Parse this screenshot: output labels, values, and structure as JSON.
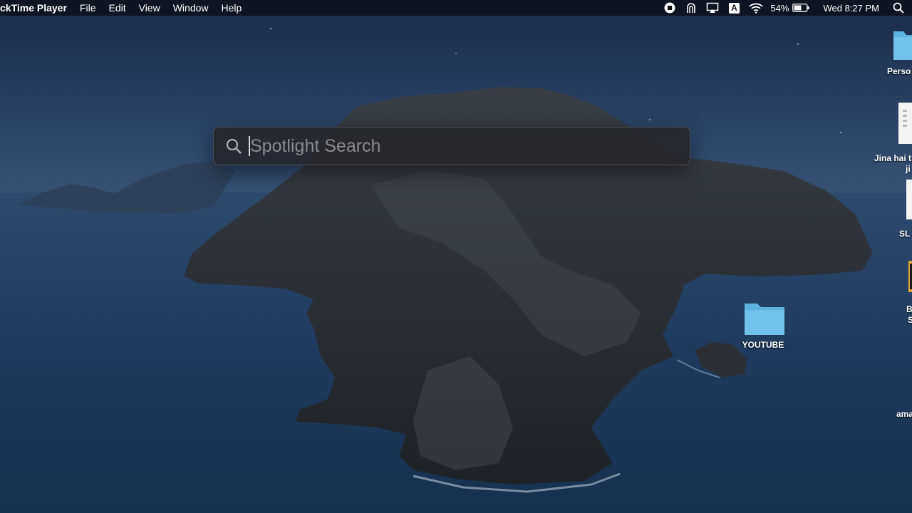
{
  "menubar": {
    "app_name": "ckTime Player",
    "menus": [
      "File",
      "Edit",
      "View",
      "Window",
      "Help"
    ],
    "status": {
      "battery_percent": "54%",
      "clock": "Wed 8:27 PM",
      "input_source": "A"
    },
    "icons": [
      "screen-record-stop-icon",
      "accessibility-icon",
      "airplay-icon",
      "input-source-icon",
      "wifi-icon",
      "battery-icon",
      "spotlight-icon"
    ]
  },
  "spotlight": {
    "placeholder": "Spotlight Search",
    "value": ""
  },
  "desktop": {
    "items": [
      {
        "label": "Perso",
        "kind": "folder"
      },
      {
        "label": "Jina hai t",
        "label2": "ji",
        "kind": "document"
      },
      {
        "label": "SL",
        "kind": "document"
      },
      {
        "label": "B",
        "label2": "S",
        "kind": "media"
      },
      {
        "label": "YOUTUBE",
        "kind": "folder"
      },
      {
        "label": "ama",
        "kind": "document"
      }
    ]
  },
  "colors": {
    "menubar_bg": "#0e121e",
    "folder_blue": "#5fb3e0",
    "spotlight_bg": "#26262a"
  }
}
